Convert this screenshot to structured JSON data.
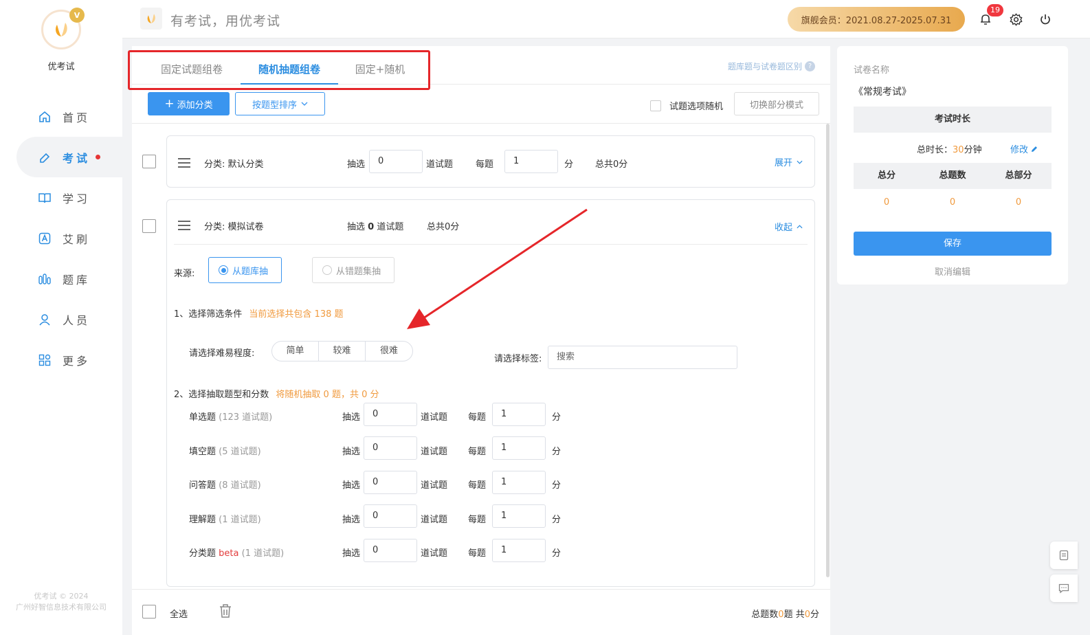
{
  "brand": {
    "name": "优考试",
    "slogan": "有考试，用优考试",
    "copyright_line1": "优考试 © 2024",
    "copyright_line2": "广州好智信息技术有限公司",
    "crown_letter": "V"
  },
  "nav": [
    {
      "label": "首页",
      "icon": "home-icon"
    },
    {
      "label": "考试",
      "icon": "exam-icon",
      "active": true,
      "dot": true
    },
    {
      "label": "学习",
      "icon": "book-icon"
    },
    {
      "label": "艾刷",
      "icon": "a-icon"
    },
    {
      "label": "题库",
      "icon": "bank-icon"
    },
    {
      "label": "人员",
      "icon": "person-icon"
    },
    {
      "label": "更多",
      "icon": "grid-icon"
    }
  ],
  "header": {
    "vip_text": "旗舰会员：2021.08.27-2025.07.31",
    "notifications": "19"
  },
  "tabs": [
    {
      "label": "固定试题组卷"
    },
    {
      "label": "随机抽题组卷",
      "active": true
    },
    {
      "label": "固定+随机"
    }
  ],
  "diff_link": "题库题与试卷题区别",
  "toolbar": {
    "add_category": "添加分类",
    "sort_by": "按题型排序",
    "random_option": "试题选项随机",
    "switch_mode": "切换部分模式"
  },
  "category1": {
    "name": "分类: 默认分类",
    "pick_label": "抽选",
    "pick_value": "0",
    "unit": "道试题",
    "per_label": "每题",
    "per_value": "1",
    "score_unit": "分",
    "total": "总共0分",
    "toggle": "展开"
  },
  "category2": {
    "name": "分类: 模拟试卷",
    "summary_pre": "抽选",
    "summary_count": "0",
    "summary_post": "道试题",
    "total": "总共0分",
    "toggle": "收起",
    "source_label": "来源:",
    "source_opt1": "从题库抽",
    "source_opt2": "从错题集抽",
    "step1_title": "1、选择筛选条件",
    "step1_note": "当前选择共包含 138 题",
    "difficulty_label": "请选择难易程度:",
    "difficulty": [
      "简单",
      "较难",
      "很难"
    ],
    "tag_label": "请选择标签:",
    "tag_placeholder": "搜索",
    "step2_title": "2、选择抽取题型和分数",
    "step2_note": "将随机抽取 0 题，共 0 分",
    "pick_label": "抽选",
    "unit": "道试题",
    "per_label": "每题",
    "score_unit": "分",
    "types": [
      {
        "name": "单选题",
        "extra": "",
        "count": "(123 道试题)",
        "pick": "0",
        "per": "1"
      },
      {
        "name": "填空题",
        "extra": "",
        "count": "(5 道试题)",
        "pick": "0",
        "per": "1"
      },
      {
        "name": "问答题",
        "extra": "",
        "count": "(8 道试题)",
        "pick": "0",
        "per": "1"
      },
      {
        "name": "理解题",
        "extra": "",
        "count": "(1 道试题)",
        "pick": "0",
        "per": "1"
      },
      {
        "name": "分类题",
        "extra": "beta",
        "count": "(1 道试题)",
        "pick": "0",
        "per": "1"
      }
    ]
  },
  "footer": {
    "select_all": "全选",
    "summary_pre": "总题数",
    "summary_count": "0",
    "summary_mid": "题 共",
    "summary_score": "0",
    "summary_post": "分"
  },
  "right": {
    "paper_name_label": "试卷名称",
    "paper_name": "《常规考试》",
    "duration_title": "考试时长",
    "duration_label": "总时长：",
    "duration_value": "30",
    "duration_unit": "分钟",
    "modify": "修改",
    "stats_headers": [
      "总分",
      "总题数",
      "总部分"
    ],
    "stats_values": [
      "0",
      "0",
      "0"
    ],
    "save": "保存",
    "cancel": "取消编辑"
  }
}
